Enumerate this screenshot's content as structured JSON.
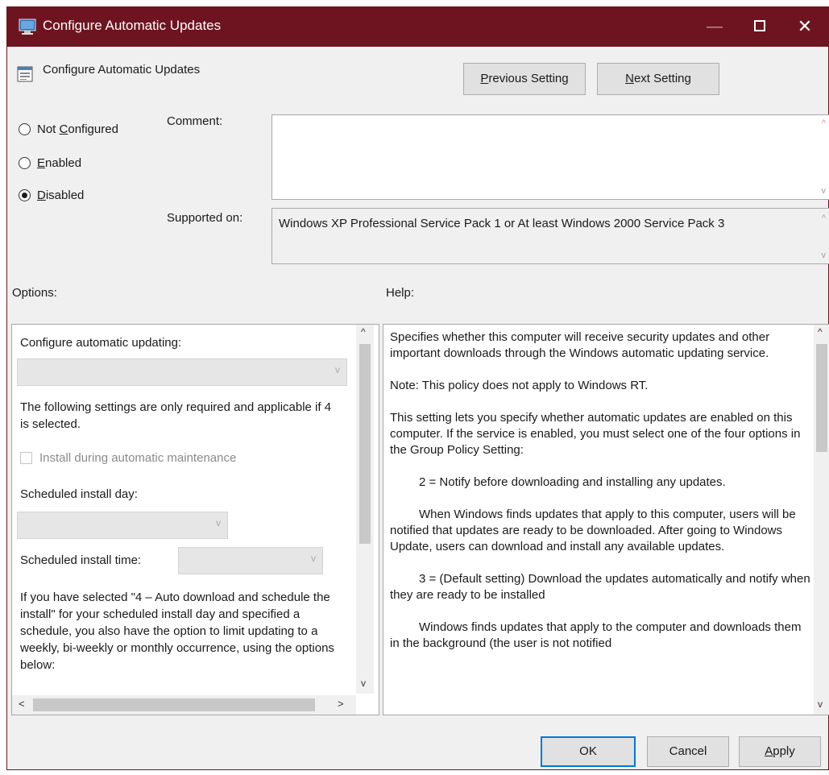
{
  "window": {
    "title": "Configure Automatic Updates",
    "minimize_glyph": "—",
    "close_glyph": "✕"
  },
  "header": {
    "policy_name": "Configure Automatic Updates",
    "previous_setting": {
      "mnemonic": "P",
      "rest": "revious Setting"
    },
    "next_setting": {
      "mnemonic": "N",
      "rest": "ext Setting"
    }
  },
  "state": {
    "options": [
      {
        "prefix": "Not ",
        "mnemonic": "C",
        "rest": "onfigured",
        "checked": false
      },
      {
        "prefix": "",
        "mnemonic": "E",
        "rest": "nabled",
        "checked": false
      },
      {
        "prefix": "",
        "mnemonic": "D",
        "rest": "isabled",
        "checked": true
      }
    ]
  },
  "comment": {
    "label": "Comment:",
    "value": ""
  },
  "supported_on": {
    "label": "Supported on:",
    "value": "Windows XP Professional Service Pack 1 or At least Windows 2000 Service Pack 3"
  },
  "options_section": {
    "label": "Options:",
    "configure_label": "Configure automatic updating:",
    "configure_value": "",
    "required_note": "The following settings are only required and applicable if 4 is selected.",
    "install_maintenance_label": "Install during automatic maintenance",
    "install_maintenance_checked": false,
    "install_day_label": "Scheduled install day:",
    "install_day_value": "",
    "install_time_label": "Scheduled install time:",
    "install_time_value": "",
    "schedule_note": "If you have selected \"4 – Auto download and schedule the install\" for your scheduled install day and specified a schedule, you also have the option to limit updating to a weekly, bi-weekly or monthly occurrence, using the options below:"
  },
  "help_section": {
    "label": "Help:",
    "paragraphs": [
      {
        "text": "Specifies whether this computer will receive security updates and other important downloads through the Windows automatic updating service.",
        "indent": false
      },
      {
        "text": "Note: This policy does not apply to Windows RT.",
        "indent": false
      },
      {
        "text": "This setting lets you specify whether automatic updates are enabled on this computer. If the service is enabled, you must select one of the four options in the Group Policy Setting:",
        "indent": false
      },
      {
        "text": "2 = Notify before downloading and installing any updates.",
        "indent": true
      },
      {
        "text": "When Windows finds updates that apply to this computer, users will be notified that updates are ready to be downloaded. After going to Windows Update, users can download and install any available updates.",
        "indent": true
      },
      {
        "text": "3 = (Default setting) Download the updates automatically and notify when they are ready to be installed",
        "indent": true
      },
      {
        "text": "Windows finds updates that apply to the computer and downloads them in the background (the user is not notified",
        "indent": true
      }
    ]
  },
  "footer": {
    "ok_label": "OK",
    "cancel_label": "Cancel",
    "apply": {
      "mnemonic": "A",
      "rest": "pply"
    }
  },
  "icons": {
    "scroll_up": "^",
    "scroll_down": "v",
    "scroll_left": "<",
    "scroll_right": ">",
    "dropdown": "v"
  },
  "colors": {
    "titlebar": "#6e1420",
    "dialog_bg": "#f0f0f0",
    "default_button_border": "#0078d7"
  }
}
